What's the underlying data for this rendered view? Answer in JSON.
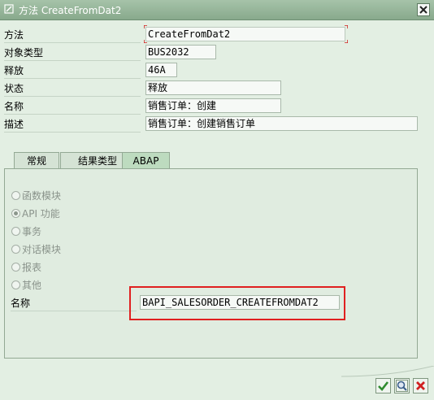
{
  "window": {
    "title": "方法 CreateFromDat2",
    "title_icon": "edit-window-icon",
    "close_icon": "close-icon"
  },
  "fields": [
    {
      "label": "方法",
      "value": "CreateFromDat2"
    },
    {
      "label": "对象类型",
      "value": "BUS2032"
    },
    {
      "label": "释放",
      "value": "46A"
    },
    {
      "label": "状态",
      "value": "释放"
    },
    {
      "label": "名称",
      "value": "销售订单：创建"
    },
    {
      "label": "描述",
      "value": "销售订单：创建销售订单"
    }
  ],
  "tabs": [
    {
      "label": "常规",
      "active": false
    },
    {
      "label": "结果类型",
      "active": false
    },
    {
      "label": "ABAP",
      "active": true
    }
  ],
  "abap": {
    "options": [
      {
        "label": "函数模块",
        "selected": false
      },
      {
        "label": "API 功能",
        "selected": true
      },
      {
        "label": "事务",
        "selected": false
      },
      {
        "label": "对话模块",
        "selected": false
      },
      {
        "label": "报表",
        "selected": false
      },
      {
        "label": "其他",
        "selected": false
      }
    ],
    "name_label": "名称",
    "name_value": "BAPI_SALESORDER_CREATEFROMDAT2"
  },
  "footer_buttons": [
    {
      "icon": "checkmark-icon",
      "color": "#2e8b2e"
    },
    {
      "icon": "magnifier-icon",
      "color": "#3a5d8a"
    },
    {
      "icon": "cancel-x-icon",
      "color": "#d02020"
    }
  ],
  "colors": {
    "highlight_box": "#e02020"
  }
}
